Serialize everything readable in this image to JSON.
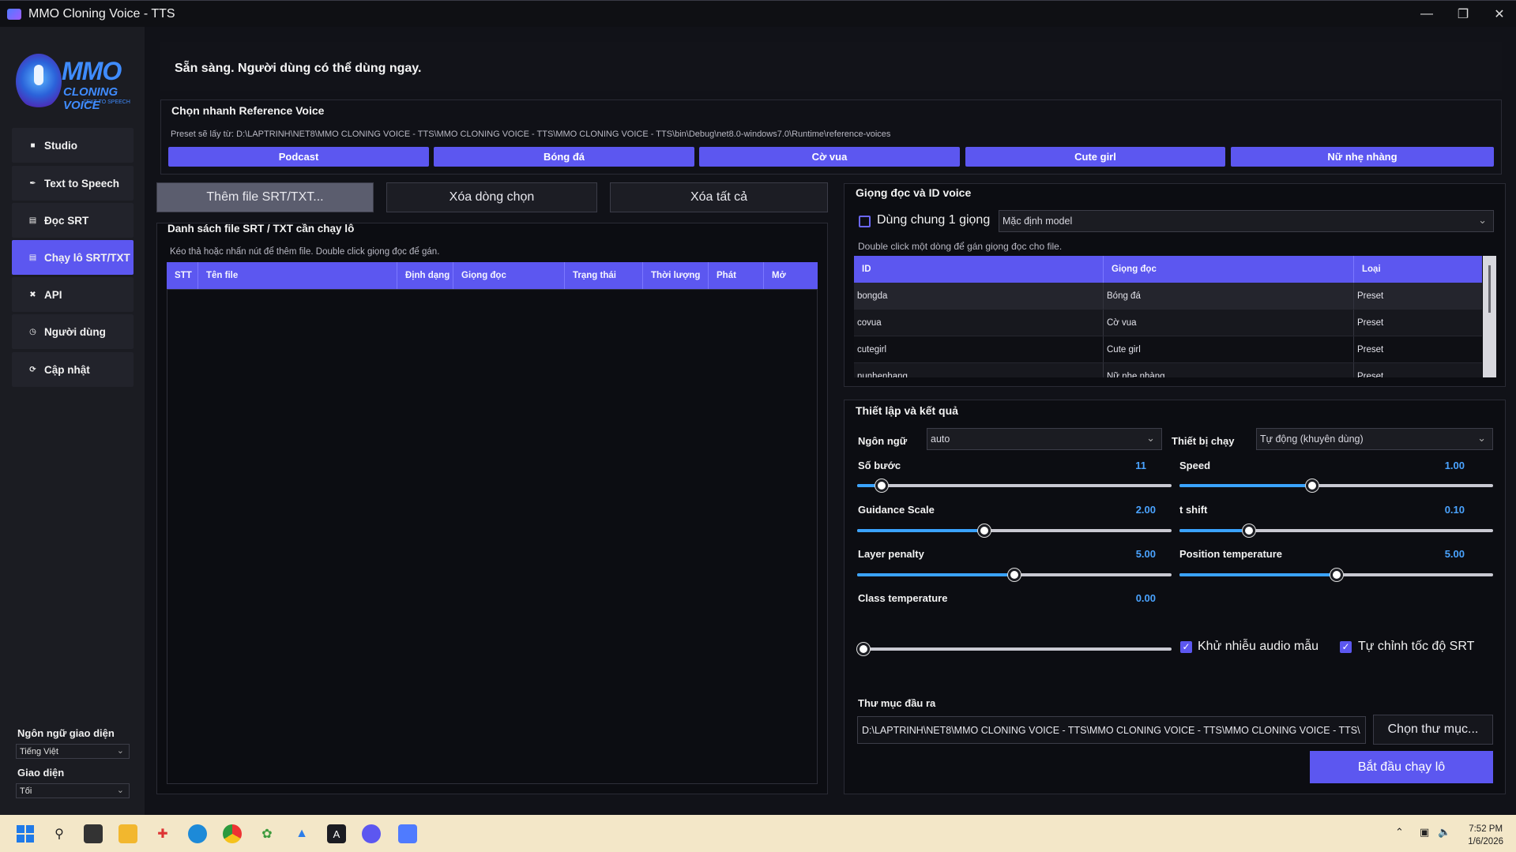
{
  "window": {
    "title": "MMO Cloning Voice - TTS"
  },
  "logo": {
    "brand": "MMO",
    "brand2": "CLONING VOICE",
    "brand3": "TEXT TO SPEECH"
  },
  "sidebar": {
    "items": [
      {
        "label": "Studio",
        "icon": "studio-icon"
      },
      {
        "label": "Text to Speech",
        "icon": "pen-icon"
      },
      {
        "label": "Đọc SRT",
        "icon": "doc-icon"
      },
      {
        "label": "Chạy lô SRT/TXT",
        "icon": "batch-icon"
      },
      {
        "label": "API",
        "icon": "api-icon"
      },
      {
        "label": "Người dùng",
        "icon": "user-icon"
      },
      {
        "label": "Cập nhật",
        "icon": "refresh-icon"
      }
    ],
    "ui_language_label": "Ngôn ngữ giao diện",
    "ui_language_value": "Tiếng Việt",
    "theme_label": "Giao diện",
    "theme_value": "Tối"
  },
  "status": {
    "text": "Sẵn sàng. Người dùng có thể dùng ngay."
  },
  "reference_voice": {
    "title": "Chọn nhanh Reference Voice",
    "preset_path": "Preset sẽ lấy từ: D:\\LAPTRINH\\NET8\\MMO CLONING VOICE - TTS\\MMO CLONING VOICE - TTS\\MMO CLONING VOICE - TTS\\bin\\Debug\\net8.0-windows7.0\\Runtime\\reference-voices",
    "presets": [
      "Podcast",
      "Bóng đá",
      "Cờ vua",
      "Cute girl",
      "Nữ nhẹ nhàng"
    ]
  },
  "file_actions": {
    "add": "Thêm file SRT/TXT...",
    "remove_selected": "Xóa dòng chọn",
    "remove_all": "Xóa tất cả"
  },
  "file_list": {
    "title": "Danh sách file SRT / TXT cần chạy lô",
    "hint": "Kéo thả hoặc nhấn nút để thêm file. Double click giọng đọc để gán.",
    "columns": [
      "STT",
      "Tên file",
      "Định dạng",
      "Giọng đọc",
      "Trạng thái",
      "Thời lượng",
      "Phát",
      "Mở"
    ]
  },
  "voice_panel": {
    "title": "Giọng đọc và ID voice",
    "shared_voice_label": "Dùng chung 1 giọng",
    "model_placeholder": "Mặc định model",
    "hint": "Double click một dòng để gán giọng đọc cho file.",
    "columns": [
      "ID",
      "Giọng đọc",
      "Loại"
    ],
    "rows": [
      {
        "id": "bongda",
        "voice": "Bóng đá",
        "type": "Preset"
      },
      {
        "id": "covua",
        "voice": "Cờ vua",
        "type": "Preset"
      },
      {
        "id": "cutegirl",
        "voice": "Cute girl",
        "type": "Preset"
      },
      {
        "id": "nunhenhang",
        "voice": "Nữ nhẹ nhàng",
        "type": "Preset"
      }
    ]
  },
  "settings": {
    "title": "Thiết lập và kết quả",
    "language_label": "Ngôn ngữ",
    "language_value": "auto",
    "device_label": "Thiết bị chạy",
    "device_value": "Tự động (khuyên dùng)",
    "params": [
      {
        "label": "Số bước",
        "value": "11",
        "fraction": 0.06
      },
      {
        "label": "Speed",
        "value": "1.00",
        "fraction": 0.42
      },
      {
        "label": "Guidance Scale",
        "value": "2.00",
        "fraction": 0.4
      },
      {
        "label": "t shift",
        "value": "0.10",
        "fraction": 0.21
      },
      {
        "label": "Layer penalty",
        "value": "5.00",
        "fraction": 0.5
      },
      {
        "label": "Position temperature",
        "value": "5.00",
        "fraction": 0.5
      },
      {
        "label": "Class temperature",
        "value": "0.00",
        "fraction": 0.0
      }
    ],
    "denoise_label": "Khử nhiễu audio mẫu",
    "auto_speed_label": "Tự chỉnh tốc độ SRT",
    "output_label": "Thư mục đầu ra",
    "output_path": "D:\\LAPTRINH\\NET8\\MMO CLONING VOICE - TTS\\MMO CLONING VOICE - TTS\\MMO CLONING VOICE - TTS\\",
    "choose_folder": "Chọn thư mục...",
    "start": "Bắt đầu chạy lô"
  },
  "taskbar": {
    "time": "7:52 PM",
    "date": "1/6/2026"
  },
  "colors": {
    "accent": "#5c57f0",
    "value_blue": "#4aa3ff"
  }
}
